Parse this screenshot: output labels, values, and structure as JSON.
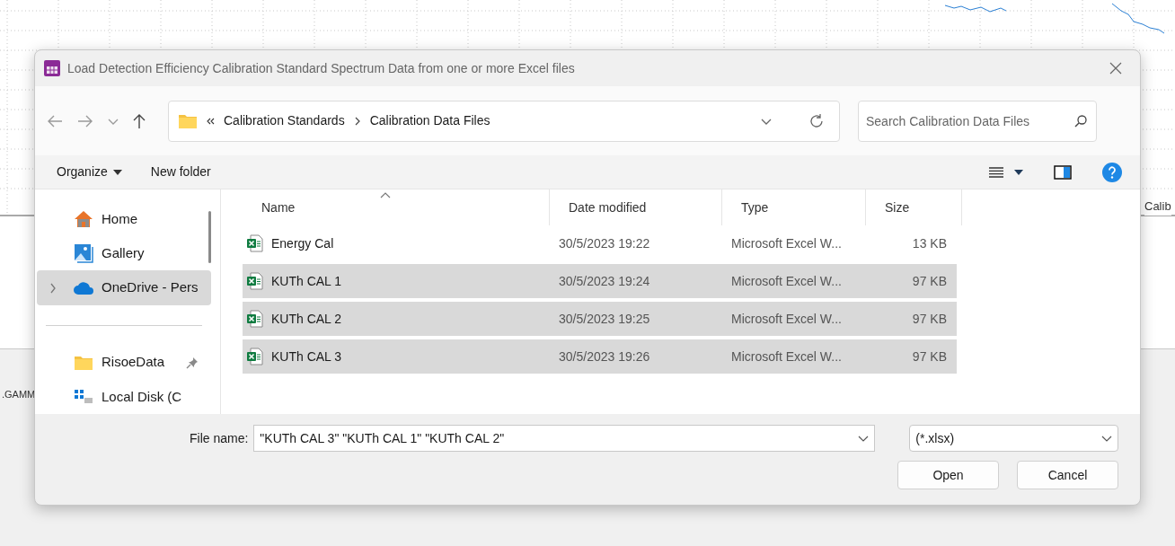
{
  "background": {
    "labels": [
      ".GAMM",
      "Calib"
    ]
  },
  "window": {
    "title": "Load Detection Efficiency Calibration Standard Spectrum Data from one or more Excel files"
  },
  "address": {
    "breadcrumbs": [
      "Calibration Standards",
      "Calibration Data Files"
    ]
  },
  "search": {
    "placeholder": "Search Calibration Data Files"
  },
  "toolbar": {
    "buttons": [
      "Organize",
      "New folder"
    ]
  },
  "nav": {
    "items": [
      {
        "label": "Home",
        "kind": "home",
        "selected": false,
        "pinned": false,
        "expandable": false
      },
      {
        "label": "Gallery",
        "kind": "gallery",
        "selected": false,
        "pinned": false,
        "expandable": false
      },
      {
        "label": "OneDrive - Pers",
        "kind": "cloud",
        "selected": true,
        "pinned": false,
        "expandable": true
      },
      {
        "label": "RisoeData",
        "kind": "folder",
        "selected": false,
        "pinned": true,
        "expandable": false
      },
      {
        "label": "Local Disk (C",
        "kind": "drive",
        "selected": false,
        "pinned": false,
        "expandable": false
      }
    ]
  },
  "files": {
    "columns": [
      "Name",
      "Date modified",
      "Type",
      "Size"
    ],
    "rows": [
      {
        "name": "Energy Cal",
        "date": "30/5/2023 19:22",
        "type": "Microsoft Excel W...",
        "size": "13 KB",
        "selected": false
      },
      {
        "name": "KUTh CAL 1",
        "date": "30/5/2023 19:24",
        "type": "Microsoft Excel W...",
        "size": "97 KB",
        "selected": true
      },
      {
        "name": "KUTh CAL 2",
        "date": "30/5/2023 19:25",
        "type": "Microsoft Excel W...",
        "size": "97 KB",
        "selected": true
      },
      {
        "name": "KUTh CAL 3",
        "date": "30/5/2023 19:26",
        "type": "Microsoft Excel W...",
        "size": "97 KB",
        "selected": true
      }
    ]
  },
  "file_name": {
    "label": "File name:",
    "value": "\"KUTh CAL 3\" \"KUTh CAL 1\" \"KUTh CAL 2\""
  },
  "file_type": {
    "value": "(*.xlsx)"
  },
  "buttons": [
    "Open",
    "Cancel"
  ]
}
